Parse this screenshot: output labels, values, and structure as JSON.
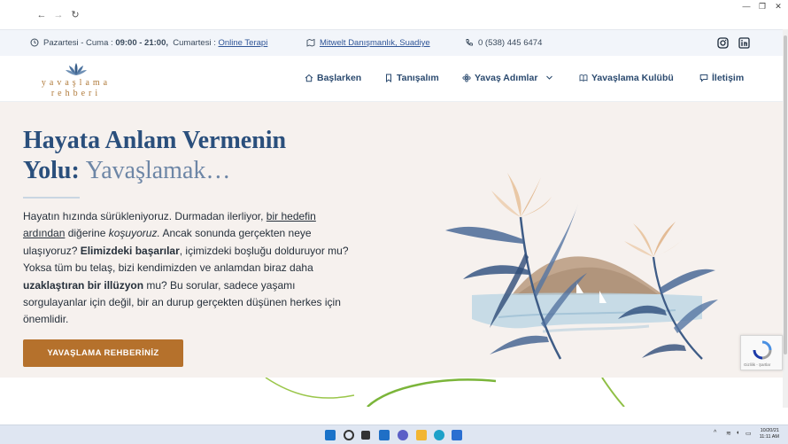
{
  "topbar": {
    "hours_prefix": "Pazartesi - Cuma : ",
    "hours_weekday": "09:00 - 21:00,",
    "hours_sat_prefix": "Cumartesi : ",
    "hours_sat_link": "Online Terapi",
    "address": "Mitwelt Danışmanlık, Suadiye",
    "phone": "0 (538) 445 6474"
  },
  "logo": {
    "line1": "yavaşlama",
    "line2": "rehberi"
  },
  "menu": {
    "items": [
      "Başlarken",
      "Tanışalım",
      "Yavaş Adımlar",
      "Yavaşlama Kulübü",
      "İletişim"
    ]
  },
  "hero": {
    "title_line1": "Hayata Anlam Vermenin",
    "title_line2_a": "Yolu: ",
    "title_line2_b": "Yavaşlamak…",
    "p1": "Hayatın hızında sürükleniyoruz. Durmadan ilerliyor, ",
    "p2_link": "bir hedefin ardından",
    "p3": " diğerine ",
    "p4_italic": "koşuyoruz.",
    "p5": " Ancak sonunda gerçekten neye ulaşıyoruz? ",
    "p6_bold": "Elimizdeki başarılar",
    "p7": ", içimizdeki boşluğu dolduruyor mu? Yoksa tüm bu telaş, bizi kendimizden ve anlamdan biraz daha ",
    "p8_bold": "uzaklaştıran bir illüzyon",
    "p9": " mu? Bu sorular, sadece yaşamı sorgulayanlar için değil, bir an durup gerçekten düşünen herkes için önemlidir.",
    "cta_label": "YAVAŞLAMA REHBERİNİZ"
  },
  "recaptcha": {
    "text": "Gizlilik - Şartlar"
  },
  "taskbar": {
    "time": "10/20/21",
    "time2": "11:11 AM"
  },
  "colors": {
    "brand_blue": "#2a4f7c",
    "accent_copper": "#b5712c",
    "hero_bg": "#f6f1ee"
  }
}
